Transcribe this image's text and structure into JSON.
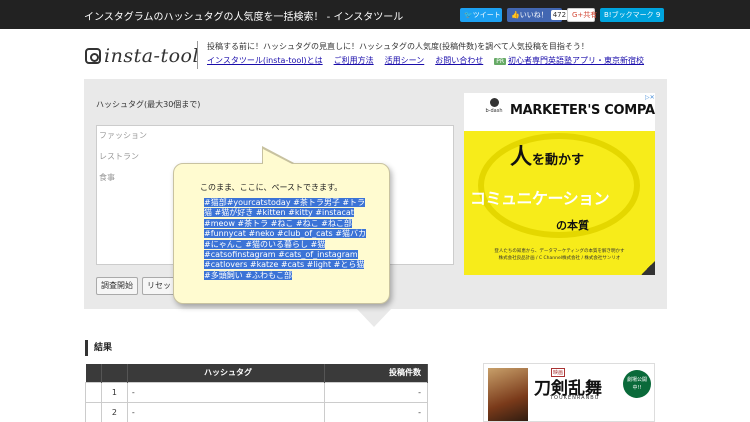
{
  "topbar": {
    "title": "インスタグラムのハッシュタグの人気度を一括検索！ - インスタツール",
    "tweet": "ツイート",
    "like": "いいね！",
    "like_count": "472",
    "gplus": "共有",
    "hatena": "B!ブックマーク 9"
  },
  "header": {
    "logo": "insta-tool",
    "tagline": "投稿する前に！ハッシュタグの見直しに！ハッシュタグの人気度(投稿件数)を調べて人気投稿を目指そう！",
    "nav": [
      "インスタツール(insta-tool)とは",
      "ご利用方法",
      "活用シーン",
      "お問い合わせ"
    ],
    "pr_badge": "PR",
    "ad_link": "初心者専門英語塾アプリ・東京新宿校"
  },
  "form": {
    "label": "ハッシュタグ(最大30個まで)",
    "placeholders": [
      "ファッション",
      "レストラン",
      "食事"
    ],
    "start_button": "調査開始",
    "reset_button": "リセット"
  },
  "tooltip": {
    "heading": "このまま、ここに、ペーストできます。",
    "tags": "#猫部#yourcatstoday #茶トラ男子 #トラ猫 #猫が好き #kitten #kitty #instacat #meow #茶トラ #ねこ #ねこ #ねこ部 #funnycat #neko #club_of_cats #猫バカ #にゃんこ #猫のいる暮らし #猫 #catsofinstagram #cats_of_instagram #catlovers #katze #cats #light #とら猫 #多頭飼い #ふわもこ部"
  },
  "ad": {
    "brand": "b-dash",
    "title": "MARKETER'S COMPASS",
    "line1_big": "人",
    "line1_rest": "を動かす",
    "line2": "コミュニケーション",
    "line3": "の本質",
    "footer": "登人たちの知恵から、データマーケティングの本質を解き明かす",
    "footer2": "株式会社良品計画 / C Channel株式会社 / 株式会社サンリオ"
  },
  "results": {
    "title": "結果",
    "headers": [
      "",
      "",
      "ハッシュタグ",
      "投稿件数"
    ],
    "rows": [
      {
        "num": "1",
        "tag": "-",
        "count": "-"
      },
      {
        "num": "2",
        "tag": "-",
        "count": "-"
      }
    ]
  },
  "ad2": {
    "badge": "映画",
    "title": "刀剣乱舞",
    "sub": "TOUKENRANBU",
    "stamp": "劇場公開中!!"
  },
  "colors": {
    "topbar": "#222222",
    "panel": "#e9e9e9",
    "tooltip": "#fffbd0",
    "selection": "#3b73d6",
    "ad_yellow": "#f7ec1a"
  }
}
